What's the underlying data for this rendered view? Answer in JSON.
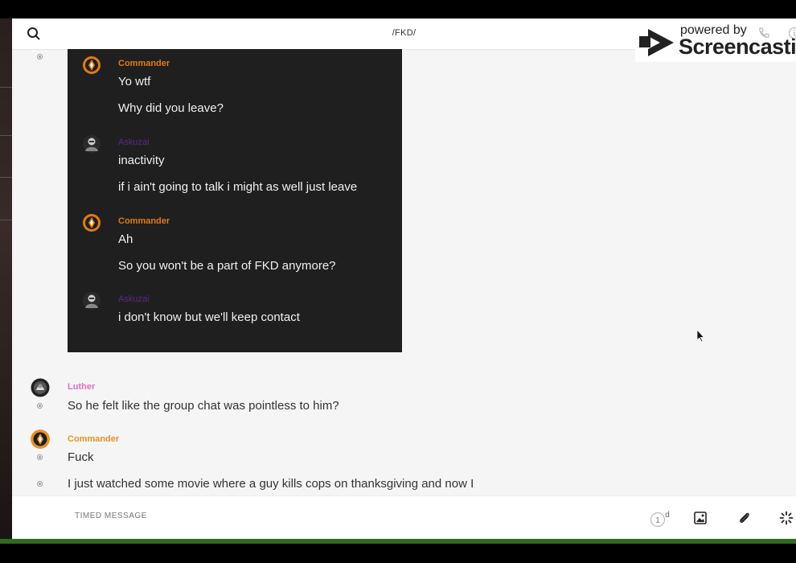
{
  "window": {
    "title": "/FKD/"
  },
  "watermark": {
    "powered": "powered by",
    "brand": "Screencastify"
  },
  "screenshot": {
    "messages": [
      {
        "author": "Commander",
        "lines": [
          "Yo wtf",
          "Why did you leave?"
        ]
      },
      {
        "author": "Askuzai",
        "lines": [
          "inactivity",
          "if i ain't going to talk i might as well just leave"
        ]
      },
      {
        "author": "Commander",
        "lines": [
          "Ah",
          "So you won't be a part of FKD anymore?"
        ]
      },
      {
        "author": "Askuzai",
        "lines": [
          "i don't know but we'll keep contact"
        ]
      }
    ]
  },
  "chat": {
    "messages": [
      {
        "author": "Luther",
        "text": "So he felt like the group chat was pointless to him?"
      },
      {
        "author": "Commander",
        "text": "Fuck"
      },
      {
        "author": "",
        "text": "I just watched some movie where a guy kills cops on thanksgiving and now I"
      }
    ]
  },
  "composer": {
    "placeholder": "TIMED MESSAGE",
    "timer_value": "1",
    "timer_unit": "d"
  },
  "colors": {
    "commander": "#e07b18",
    "luther": "#e06fbf",
    "askuzai": "#5b2a8a",
    "commander_main": "#e8902a"
  },
  "icons": [
    "search-icon",
    "phone-icon",
    "info-icon",
    "image-icon",
    "paperclip-icon",
    "sparkle-icon",
    "timer-icon"
  ]
}
